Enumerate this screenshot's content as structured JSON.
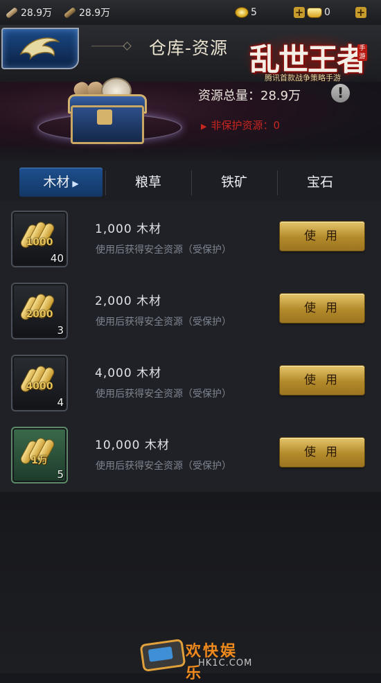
{
  "topbar": {
    "wood_amount": "28.9万",
    "wood2_amount": "28.9万",
    "coin_amount": "5",
    "ingot_amount": "0"
  },
  "header": {
    "title": "仓库-资源",
    "logo_main": "乱世王者",
    "logo_tag": "手游",
    "logo_sub": "腾讯首款战争策略手游"
  },
  "summary": {
    "total_label": "资源总量：28.9万",
    "unprotected_label": "非保护资源：0",
    "info_glyph": "!"
  },
  "tabs": [
    {
      "label": "木材",
      "active": true
    },
    {
      "label": "粮草"
    },
    {
      "label": "铁矿"
    },
    {
      "label": "宝石"
    }
  ],
  "items": [
    {
      "icon_amount": "1000",
      "count": "40",
      "title": "1,000  木材",
      "desc": "使用后获得安全资源（受保护）",
      "button": "使用"
    },
    {
      "icon_amount": "2000",
      "count": "3",
      "title": "2,000  木材",
      "desc": "使用后获得安全资源（受保护）",
      "button": "使用"
    },
    {
      "icon_amount": "4000",
      "count": "4",
      "title": "4,000  木材",
      "desc": "使用后获得安全资源（受保护）",
      "button": "使用"
    },
    {
      "icon_amount": "1万",
      "count": "5",
      "title": "10,000  木材",
      "desc": "使用后获得安全资源（受保护）",
      "button": "使用"
    }
  ],
  "watermark": {
    "text": "欢快娱乐",
    "url": "HK1C.COM"
  },
  "colors": {
    "accent_gold": "#c69a2b",
    "tab_active": "#1d4f8f",
    "warning_red": "#c8261f"
  }
}
